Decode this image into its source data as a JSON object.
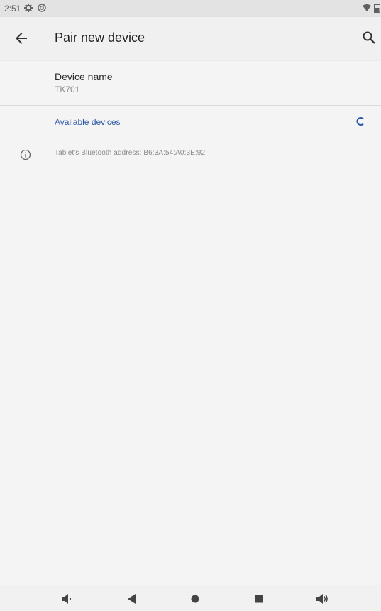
{
  "status_bar": {
    "time": "2:51",
    "icons": [
      "gear-icon",
      "circle-icon",
      "wifi-icon",
      "battery-icon"
    ]
  },
  "app_bar": {
    "title": "Pair new device",
    "back_icon": "arrow-back-icon",
    "search_icon": "search-icon"
  },
  "device_name": {
    "label": "Device name",
    "value": "TK701"
  },
  "available_devices": {
    "title": "Available devices",
    "spinner_icon": "loading-spinner-icon"
  },
  "info": {
    "icon": "info-icon",
    "text": "Tablet's Bluetooth address: B6:3A:54:A0:3E:92"
  },
  "nav_bar": {
    "icons": [
      "volume-down-icon",
      "back-triangle-icon",
      "home-circle-icon",
      "recents-square-icon",
      "volume-up-icon"
    ]
  },
  "colors": {
    "accent": "#2e5aa8",
    "background": "#f4f4f4",
    "status_bar": "#e3e3e3"
  }
}
